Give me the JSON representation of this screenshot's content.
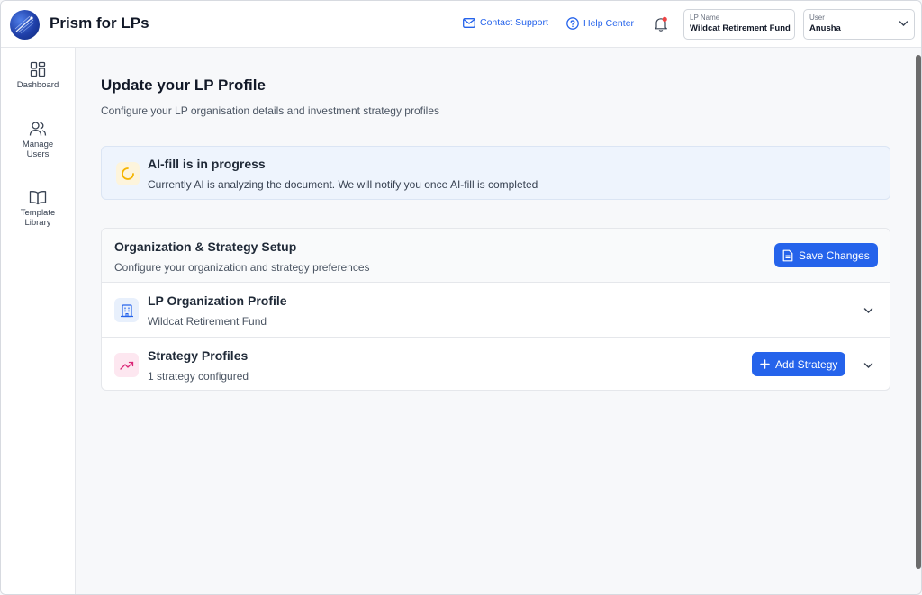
{
  "header": {
    "app_title": "Prism for LPs",
    "contact_support": "Contact Support",
    "help_center": "Help Center",
    "lp_name_label": "LP Name",
    "lp_name_value": "Wildcat Retirement Fund",
    "user_label": "User",
    "user_value": "Anusha"
  },
  "sidebar": {
    "items": [
      {
        "label": "Dashboard",
        "icon": "dashboard-grid-icon"
      },
      {
        "label": "Manage Users",
        "icon": "users-icon"
      },
      {
        "label": "Template Library",
        "icon": "book-icon"
      }
    ]
  },
  "main": {
    "title": "Update your LP Profile",
    "subtitle": "Configure your LP organisation details and investment strategy profiles",
    "banner": {
      "title": "AI-fill is in progress",
      "text": "Currently AI is analyzing the document. We will notify you once AI-fill is completed"
    },
    "card": {
      "title": "Organization & Strategy Setup",
      "subtitle": "Configure your organization and strategy preferences",
      "save_label": "Save Changes",
      "rows": [
        {
          "title": "LP Organization Profile",
          "subtitle": "Wildcat Retirement Fund"
        },
        {
          "title": "Strategy Profiles",
          "subtitle": "1 strategy configured",
          "action_label": "Add Strategy"
        }
      ]
    }
  },
  "colors": {
    "accent": "#2563eb",
    "banner_bg": "#eef4fd",
    "notification_dot": "#ef4444",
    "spinner": "#f5b400"
  }
}
